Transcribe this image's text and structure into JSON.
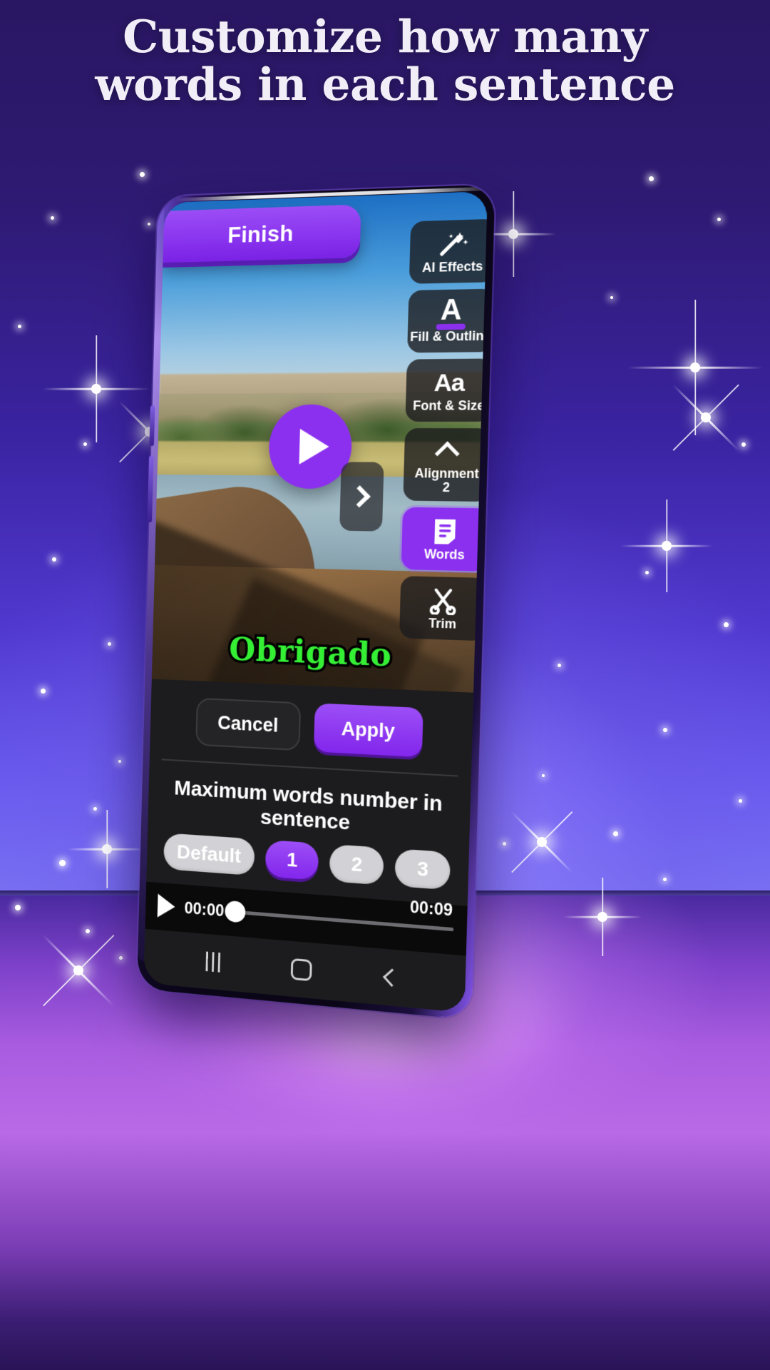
{
  "headline": {
    "line1": "Customize how many",
    "line2": "words in each sentence"
  },
  "colors": {
    "accent_purple": "#8c30f0",
    "bg_indigo": "#2c1b6e",
    "floor_magenta": "#b96ae6",
    "caption_green": "#35ef35",
    "panel_dark": "#1c1c1e"
  },
  "editor": {
    "finish_button": "Finish",
    "play_overlay_icon": "play-icon",
    "next_chevron_icon": "chevron-right-icon",
    "caption_text": "Obrigado",
    "toolbar": [
      {
        "label": "AI Effects",
        "icon": "magic-wand-icon",
        "sub": "",
        "active": false
      },
      {
        "label": "Fill & Outline",
        "icon": "letter-a-underline-icon",
        "sub": "",
        "active": false
      },
      {
        "label": "Font & Size",
        "icon": "font-size-aa-icon",
        "sub": "",
        "active": false
      },
      {
        "label": "Alignment",
        "icon": "chevron-up-icon",
        "sub": "2",
        "active": false
      },
      {
        "label": "Words",
        "icon": "document-lines-icon",
        "sub": "",
        "active": true
      },
      {
        "label": "Trim",
        "icon": "scissors-icon",
        "sub": "",
        "active": false
      }
    ]
  },
  "panel": {
    "cancel_label": "Cancel",
    "apply_label": "Apply",
    "title": "Maximum words number in sentence",
    "chips": [
      {
        "label": "Default",
        "selected": false
      },
      {
        "label": "1",
        "selected": true
      },
      {
        "label": "2",
        "selected": false
      },
      {
        "label": "3",
        "selected": false
      }
    ]
  },
  "timeline": {
    "play_icon": "play-icon",
    "current_time": "00:00",
    "total_time": "00:09",
    "progress_percent": 0
  },
  "navbar": {
    "recents_icon": "recents-icon",
    "home_icon": "home-icon",
    "back_icon": "back-icon"
  }
}
